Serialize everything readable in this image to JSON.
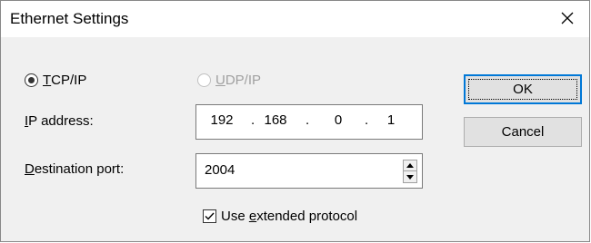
{
  "window": {
    "title": "Ethernet Settings"
  },
  "protocol": {
    "tcp_accel": "T",
    "tcp_rest": "CP/IP",
    "udp_accel": "U",
    "udp_rest": "DP/IP",
    "selected": "TCP/IP"
  },
  "ip": {
    "label_accel": "I",
    "label_rest": "P address:",
    "seg1": "192",
    "seg2": "168",
    "seg3": "0",
    "seg4": "1"
  },
  "port": {
    "label_accel": "D",
    "label_rest": "estination port:",
    "value": "2004"
  },
  "extended": {
    "pre": "Use ",
    "accel": "e",
    "post": "xtended protocol",
    "checked": true
  },
  "buttons": {
    "ok": "OK",
    "cancel": "Cancel"
  },
  "icons": {
    "close": "close-icon",
    "radio_selected": "radio-selected-icon",
    "spin_up": "up-arrow-icon",
    "spin_down": "down-arrow-icon",
    "check": "checkmark-icon"
  }
}
